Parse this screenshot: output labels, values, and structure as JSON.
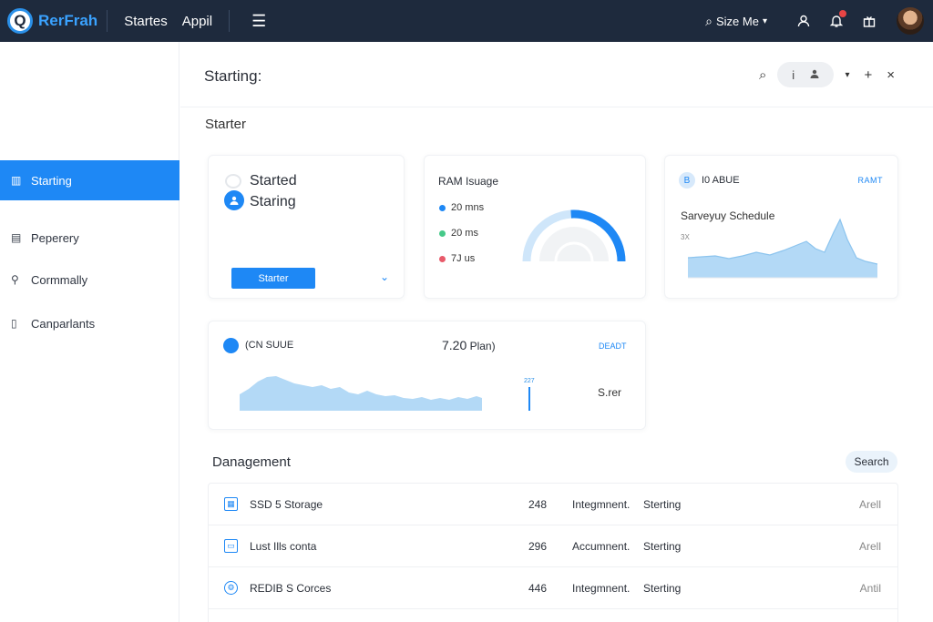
{
  "topbar": {
    "logo_glyph": "Q",
    "logo_text": "RerFrah",
    "nav": [
      "Startes",
      "Appil"
    ],
    "list_icon": "list-icon",
    "size_menu": "Size Me",
    "icons": [
      "user-outline-icon",
      "bell-icon",
      "gift-icon"
    ]
  },
  "sidebar": {
    "items": [
      {
        "label": "Starting",
        "icon": "building-icon",
        "active": true
      },
      {
        "label": "Peperery",
        "icon": "clipboard-icon",
        "active": false
      },
      {
        "label": "Cormmally",
        "icon": "key-icon",
        "active": false
      },
      {
        "label": "Canparlants",
        "icon": "columns-icon",
        "active": false
      }
    ]
  },
  "header": {
    "title": "Starting:",
    "section": "Starter",
    "pill_left": "i",
    "pill_right": "user-icon"
  },
  "card1": {
    "title1": "Started",
    "title2": "Staring",
    "button": "Starter"
  },
  "card2": {
    "title": "RAM Isuage",
    "legend": [
      {
        "label": "20 mns",
        "color": "#1e88f5"
      },
      {
        "label": "20 ms",
        "color": "#46c989"
      },
      {
        "label": "7J us",
        "color": "#e85a6a"
      }
    ],
    "gauge_fraction": 0.52,
    "colors": {
      "arc": "#1e88f5",
      "track": "#cfe6fa"
    }
  },
  "card3": {
    "header": "I0 ABUE",
    "badge": "B",
    "tag": "RAMT",
    "subtitle": "Sarveyuy Schedule",
    "ylabel": "3X"
  },
  "card4": {
    "header": "(CN SUUE",
    "value_main": "7.20",
    "value_unit": " Plan)",
    "tag": "DEADT",
    "tick_label": "227",
    "side_text": "S.rer"
  },
  "management": {
    "title": "Danagement",
    "search": "Search",
    "rows": [
      {
        "name": "SSD 5 Storage",
        "num": "248",
        "kind": "Integmnent.",
        "status": "Sterting",
        "action": "Arell"
      },
      {
        "name": "Lust Ills conta",
        "num": "296",
        "kind": "Accumnent.",
        "status": "Sterting",
        "action": "Arell"
      },
      {
        "name": "REDIB S Corces",
        "num": "446",
        "kind": "Integmnent.",
        "status": "Sterting",
        "action": "Antil"
      }
    ]
  }
}
